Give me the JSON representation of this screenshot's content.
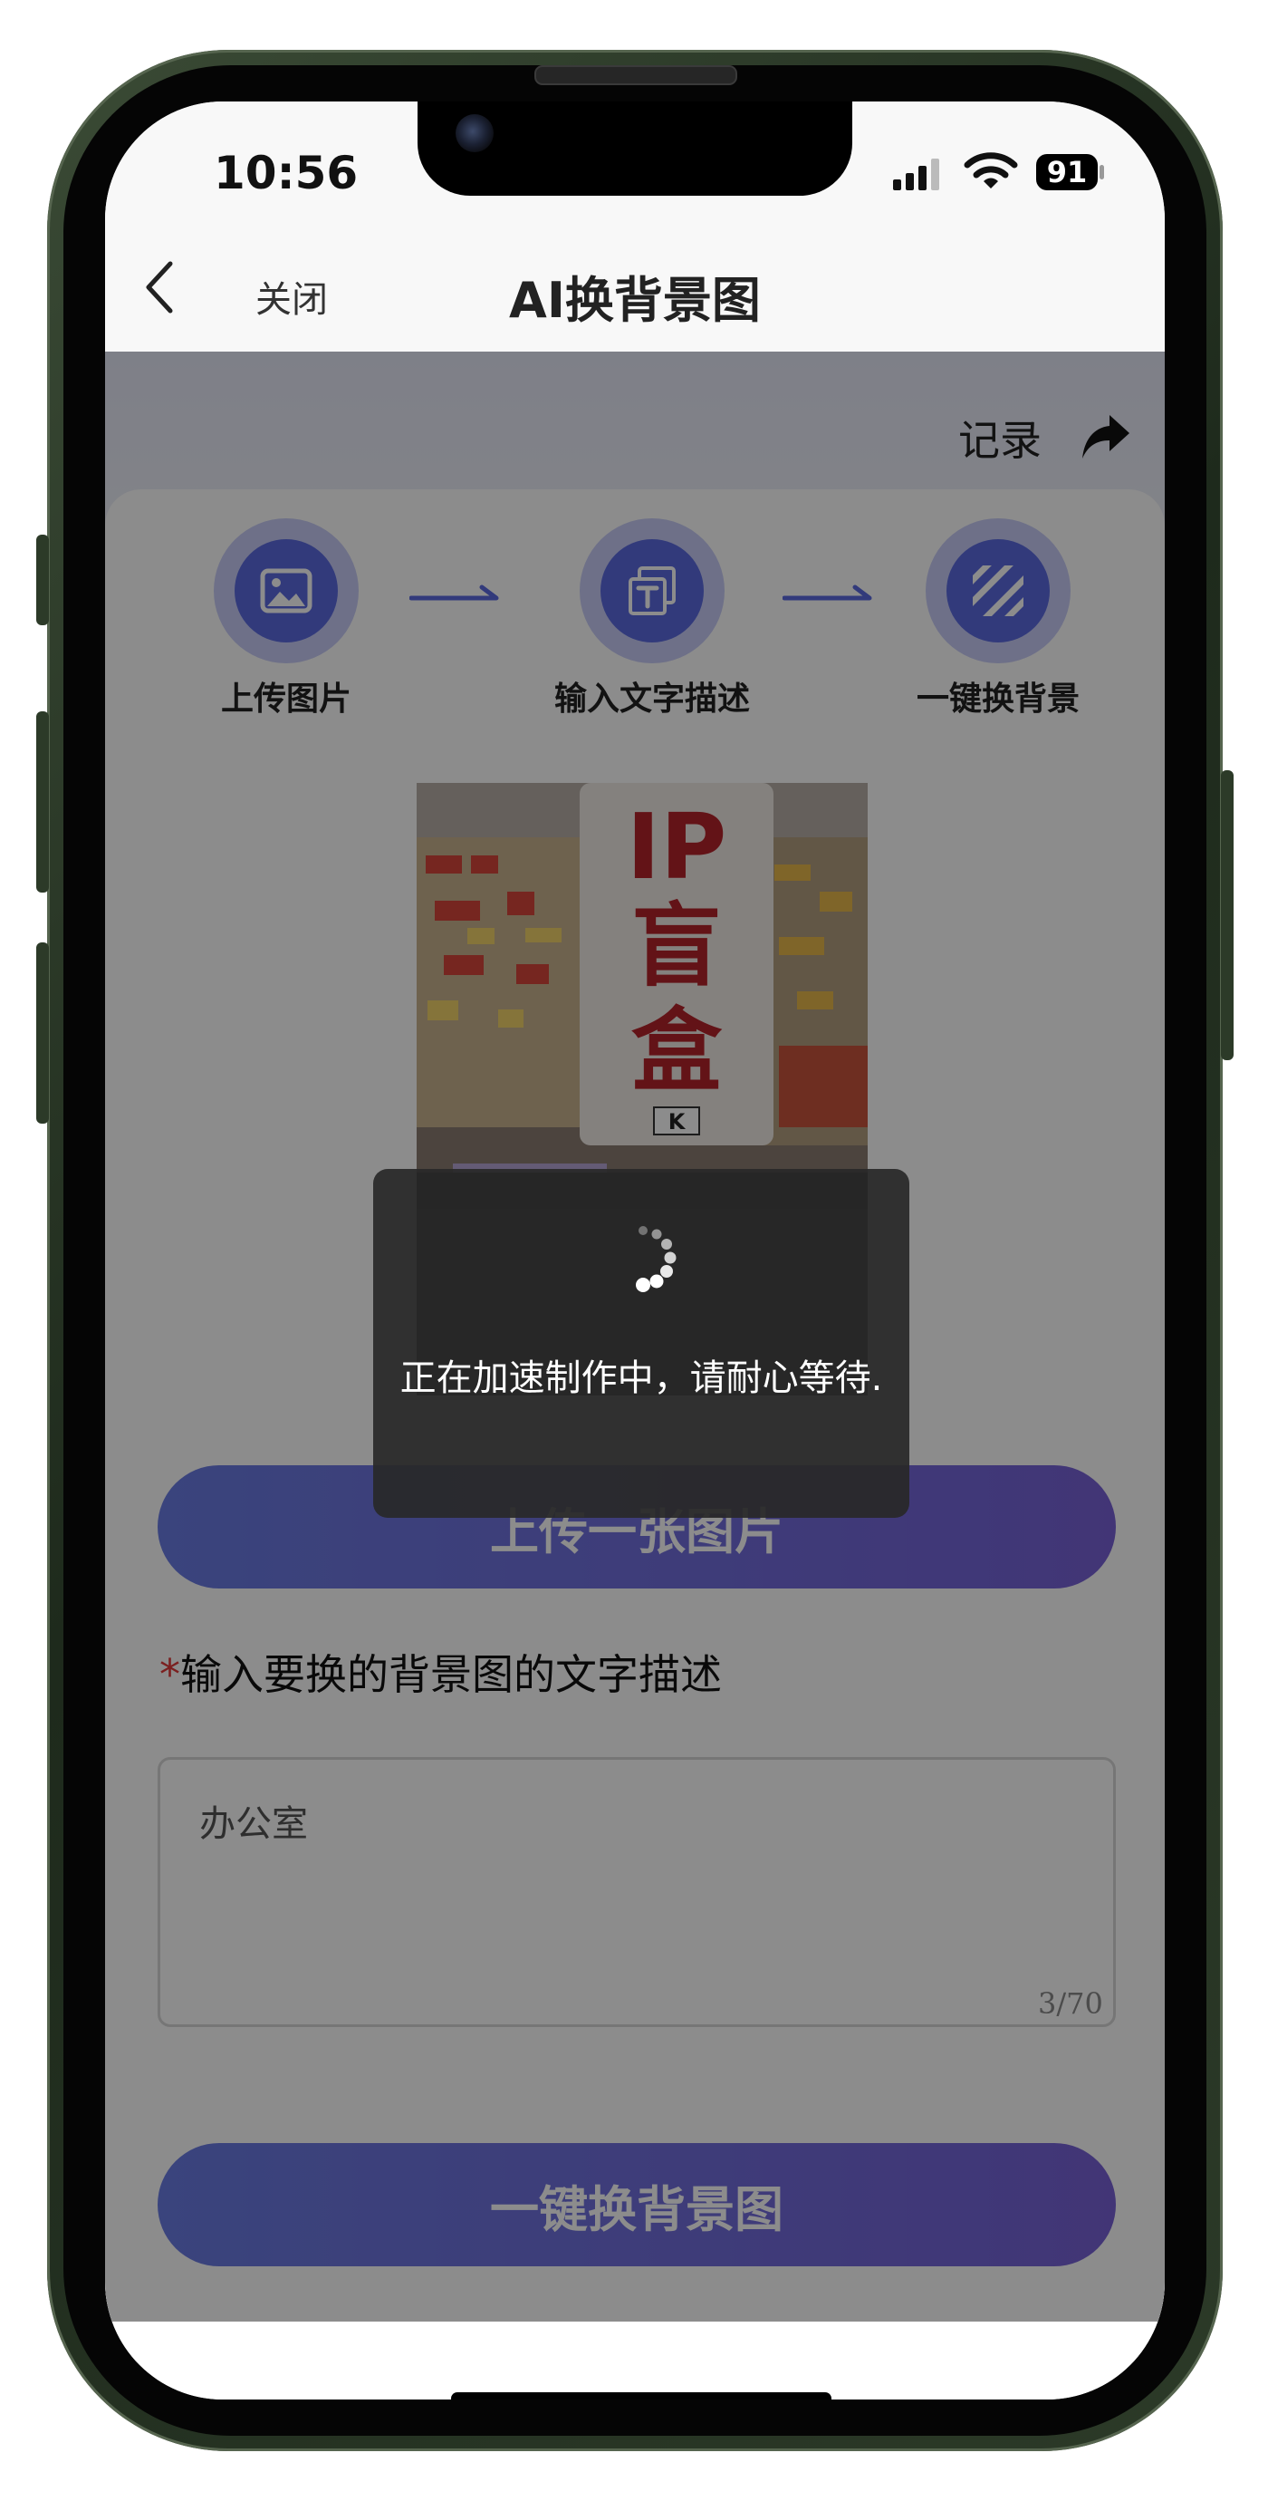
{
  "status_bar": {
    "time": "10:56",
    "battery": "91",
    "icons": [
      "signal-icon",
      "wifi-icon",
      "battery-icon"
    ]
  },
  "nav": {
    "back_icon": "chevron-left-icon",
    "close_label": "关闭",
    "title": "AI换背景图"
  },
  "header": {
    "record_label": "记录",
    "share_icon": "share-arrow-icon"
  },
  "steps": [
    {
      "label": "上传图片",
      "icon": "image-icon"
    },
    {
      "label": "输入文字描述",
      "icon": "text-icon"
    },
    {
      "label": "一键换背景",
      "icon": "stripes-icon"
    }
  ],
  "photo": {
    "sign_text": "IP盲盒",
    "tag_text": "K"
  },
  "upload_button": "上传一张图片",
  "description": {
    "required_mark": "*",
    "label": "输入要换的背景图的文字描述",
    "value": "办公室",
    "counter": "3/70"
  },
  "swap_button": "一键换背景图",
  "toast": {
    "text": "正在加速制作中，请耐心等待."
  },
  "colors": {
    "accent": "#5b6be0",
    "button_start": "#6a7ce3",
    "button_end": "#7862d8",
    "required": "#e03a3a",
    "frame": "#2c3a28"
  }
}
